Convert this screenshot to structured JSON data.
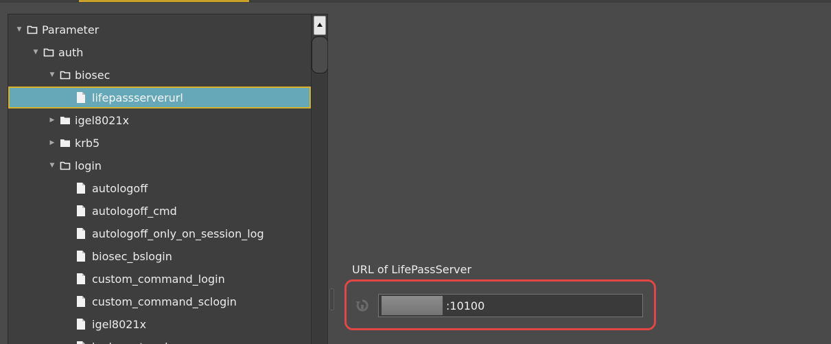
{
  "tree": {
    "items": [
      {
        "label": "Parameter",
        "type": "folder-open",
        "expander": "down",
        "level": 0
      },
      {
        "label": "auth",
        "type": "folder-open",
        "expander": "down",
        "level": 1
      },
      {
        "label": "biosec",
        "type": "folder-open",
        "expander": "down",
        "level": 2
      },
      {
        "label": "lifepassserverurl",
        "type": "file",
        "expander": "",
        "level": 3,
        "selected": true
      },
      {
        "label": "igel8021x",
        "type": "folder-closed",
        "expander": "right",
        "level": 2
      },
      {
        "label": "krb5",
        "type": "folder-closed",
        "expander": "right",
        "level": 2
      },
      {
        "label": "login",
        "type": "folder-open",
        "expander": "down",
        "level": 2
      },
      {
        "label": "autologoff",
        "type": "file",
        "expander": "",
        "level": 3
      },
      {
        "label": "autologoff_cmd",
        "type": "file",
        "expander": "",
        "level": 3
      },
      {
        "label": "autologoff_only_on_session_log",
        "type": "file",
        "expander": "",
        "level": 3
      },
      {
        "label": "biosec_bslogin",
        "type": "file",
        "expander": "",
        "level": 3
      },
      {
        "label": "custom_command_login",
        "type": "file",
        "expander": "",
        "level": 3
      },
      {
        "label": "custom_command_sclogin",
        "type": "file",
        "expander": "",
        "level": 3
      },
      {
        "label": "igel8021x",
        "type": "file",
        "expander": "",
        "level": 3
      },
      {
        "label": "igelsmartcard",
        "type": "file",
        "expander": "",
        "level": 3
      }
    ]
  },
  "setting": {
    "label": "URL of LifePassServer",
    "value": ":10100",
    "reset_icon": "reset-arrow-icon"
  },
  "colors": {
    "selection_bg": "#66a8b8",
    "selection_border": "#d8b22a",
    "highlight_border": "#e44646",
    "panel_bg": "#3e3e3e",
    "window_bg": "#4a4a4a"
  }
}
